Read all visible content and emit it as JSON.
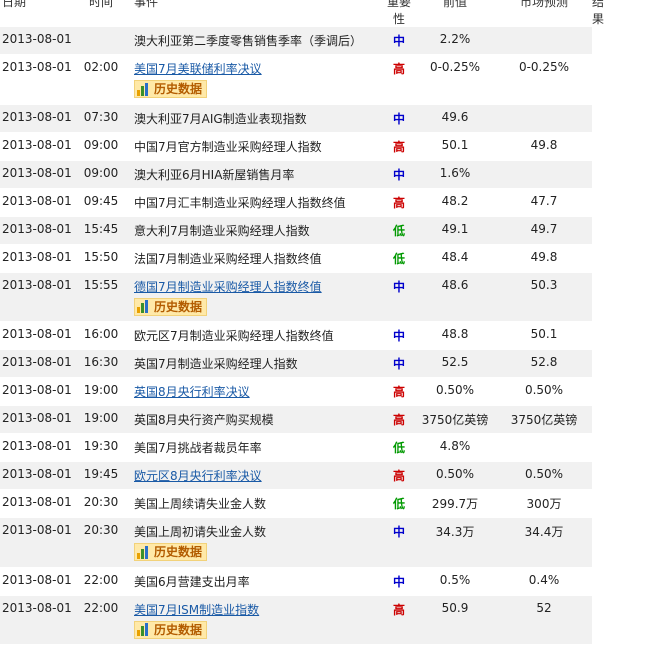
{
  "header": {
    "date": "日期",
    "time": "时间",
    "event": "事件",
    "importance": "重要性",
    "previous": "前值",
    "forecast": "市场预测",
    "result": "结果"
  },
  "history_label": "历史数据",
  "rows": [
    {
      "date": "2013-08-01",
      "time": "",
      "event": "澳大利亚第二季度零售销售季率（季调后）",
      "importance": "中",
      "previous": "2.2%",
      "forecast": "",
      "link": false,
      "history": false
    },
    {
      "date": "2013-08-01",
      "time": "02:00",
      "event": "美国7月美联储利率决议",
      "importance": "高",
      "previous": "0-0.25%",
      "forecast": "0-0.25%",
      "link": true,
      "history": true
    },
    {
      "date": "2013-08-01",
      "time": "07:30",
      "event": "澳大利亚7月AIG制造业表现指数",
      "importance": "中",
      "previous": "49.6",
      "forecast": "",
      "link": false,
      "history": false
    },
    {
      "date": "2013-08-01",
      "time": "09:00",
      "event": "中国7月官方制造业采购经理人指数",
      "importance": "高",
      "previous": "50.1",
      "forecast": "49.8",
      "link": false,
      "history": false
    },
    {
      "date": "2013-08-01",
      "time": "09:00",
      "event": "澳大利亚6月HIA新屋销售月率",
      "importance": "中",
      "previous": "1.6%",
      "forecast": "",
      "link": false,
      "history": false
    },
    {
      "date": "2013-08-01",
      "time": "09:45",
      "event": "中国7月汇丰制造业采购经理人指数终值",
      "importance": "高",
      "previous": "48.2",
      "forecast": "47.7",
      "link": false,
      "history": false
    },
    {
      "date": "2013-08-01",
      "time": "15:45",
      "event": "意大利7月制造业采购经理人指数",
      "importance": "低",
      "previous": "49.1",
      "forecast": "49.7",
      "link": false,
      "history": false
    },
    {
      "date": "2013-08-01",
      "time": "15:50",
      "event": "法国7月制造业采购经理人指数终值",
      "importance": "低",
      "previous": "48.4",
      "forecast": "49.8",
      "link": false,
      "history": false
    },
    {
      "date": "2013-08-01",
      "time": "15:55",
      "event": "德国7月制造业采购经理人指数终值",
      "importance": "中",
      "previous": "48.6",
      "forecast": "50.3",
      "link": true,
      "history": true
    },
    {
      "date": "2013-08-01",
      "time": "16:00",
      "event": "欧元区7月制造业采购经理人指数终值",
      "importance": "中",
      "previous": "48.8",
      "forecast": "50.1",
      "link": false,
      "history": false
    },
    {
      "date": "2013-08-01",
      "time": "16:30",
      "event": "英国7月制造业采购经理人指数",
      "importance": "中",
      "previous": "52.5",
      "forecast": "52.8",
      "link": false,
      "history": false
    },
    {
      "date": "2013-08-01",
      "time": "19:00",
      "event": "英国8月央行利率决议",
      "importance": "高",
      "previous": "0.50%",
      "forecast": "0.50%",
      "link": true,
      "history": false
    },
    {
      "date": "2013-08-01",
      "time": "19:00",
      "event": "英国8月央行资产购买规模",
      "importance": "高",
      "previous": "3750亿英镑",
      "forecast": "3750亿英镑",
      "link": false,
      "history": false
    },
    {
      "date": "2013-08-01",
      "time": "19:30",
      "event": "美国7月挑战者裁员年率",
      "importance": "低",
      "previous": "4.8%",
      "forecast": "",
      "link": false,
      "history": false
    },
    {
      "date": "2013-08-01",
      "time": "19:45",
      "event": "欧元区8月央行利率决议",
      "importance": "高",
      "previous": "0.50%",
      "forecast": "0.50%",
      "link": true,
      "history": false
    },
    {
      "date": "2013-08-01",
      "time": "20:30",
      "event": "美国上周续请失业金人数",
      "importance": "低",
      "previous": "299.7万",
      "forecast": "300万",
      "link": false,
      "history": false
    },
    {
      "date": "2013-08-01",
      "time": "20:30",
      "event": "美国上周初请失业金人数",
      "importance": "中",
      "previous": "34.3万",
      "forecast": "34.4万",
      "link": false,
      "history": true
    },
    {
      "date": "2013-08-01",
      "time": "22:00",
      "event": "美国6月营建支出月率",
      "importance": "中",
      "previous": "0.5%",
      "forecast": "0.4%",
      "link": false,
      "history": false
    },
    {
      "date": "2013-08-01",
      "time": "22:00",
      "event": "美国7月ISM制造业指数",
      "importance": "高",
      "previous": "50.9",
      "forecast": "52",
      "link": true,
      "history": true
    }
  ],
  "colors": {
    "high": "#cc0000",
    "mid": "#0000cc",
    "low": "#009900",
    "link": "#1a5aa6",
    "row_alt": "#f1f1f1"
  }
}
